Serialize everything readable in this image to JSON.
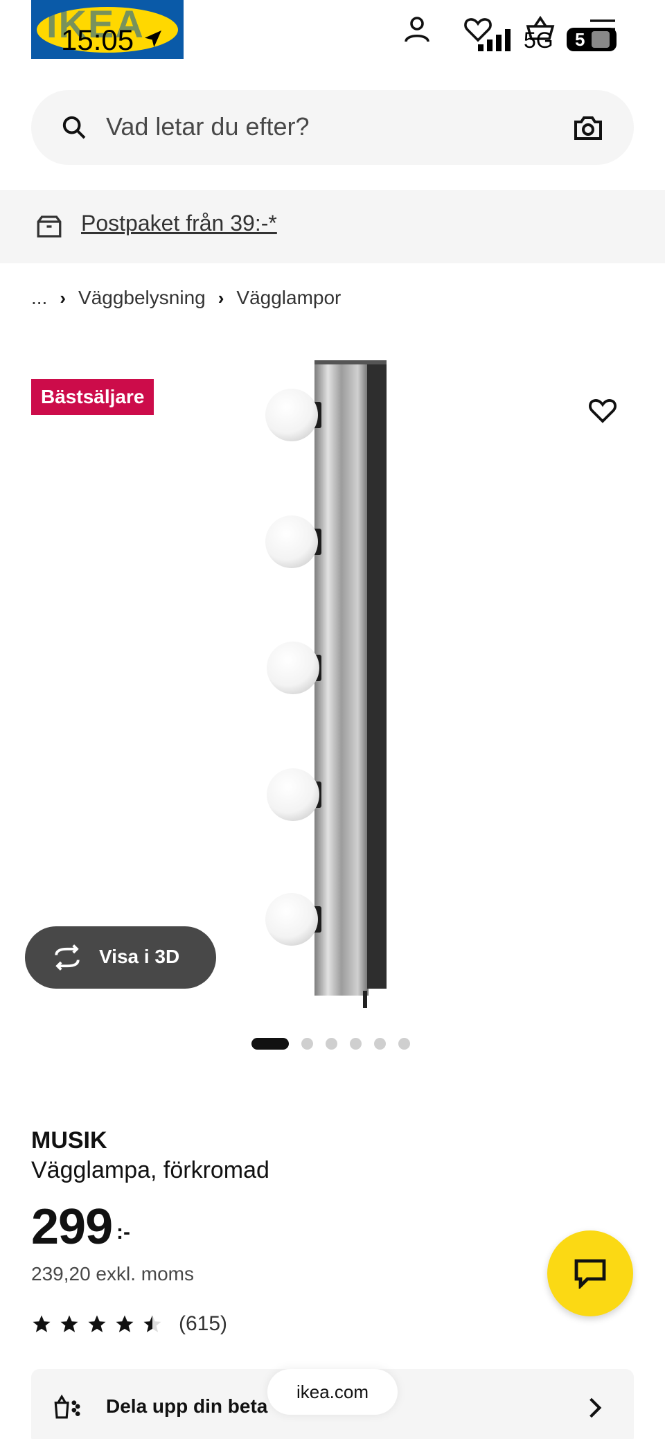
{
  "status_bar": {
    "time": "15:05",
    "network": "5G",
    "battery": "5"
  },
  "header": {
    "logo_text": "IKEA"
  },
  "search": {
    "placeholder": "Vad letar du efter?"
  },
  "banner": {
    "text": "Postpaket från 39:-*"
  },
  "breadcrumb": {
    "ellipsis": "...",
    "items": [
      "Väggbelysning",
      "Vägglampor"
    ]
  },
  "product": {
    "badge": "Bästsäljare",
    "view_3d_label": "Visa i 3D",
    "image_count": 6,
    "active_image": 1,
    "name": "MUSIK",
    "description": "Vägglampa, förkromad",
    "price": "299",
    "price_suffix": ":-",
    "price_excl_vat": "239,20 exkl. moms",
    "rating": 4.5,
    "rating_max": 5,
    "review_count": "(615)"
  },
  "payment": {
    "label": "Dela upp din beta"
  },
  "browser": {
    "url": "ikea.com"
  },
  "colors": {
    "accent_badge": "#cc0c4a",
    "chat_button": "#fbd914",
    "ikea_blue": "#0a5aa8",
    "ikea_yellow": "#ffd800"
  },
  "icons": [
    "user-icon",
    "heart-icon",
    "basket-icon",
    "menu-icon",
    "search-icon",
    "camera-icon",
    "delivery-box-icon",
    "rotate-3d-icon",
    "chat-icon",
    "payment-icon",
    "chevron-right-icon",
    "star-icon"
  ]
}
